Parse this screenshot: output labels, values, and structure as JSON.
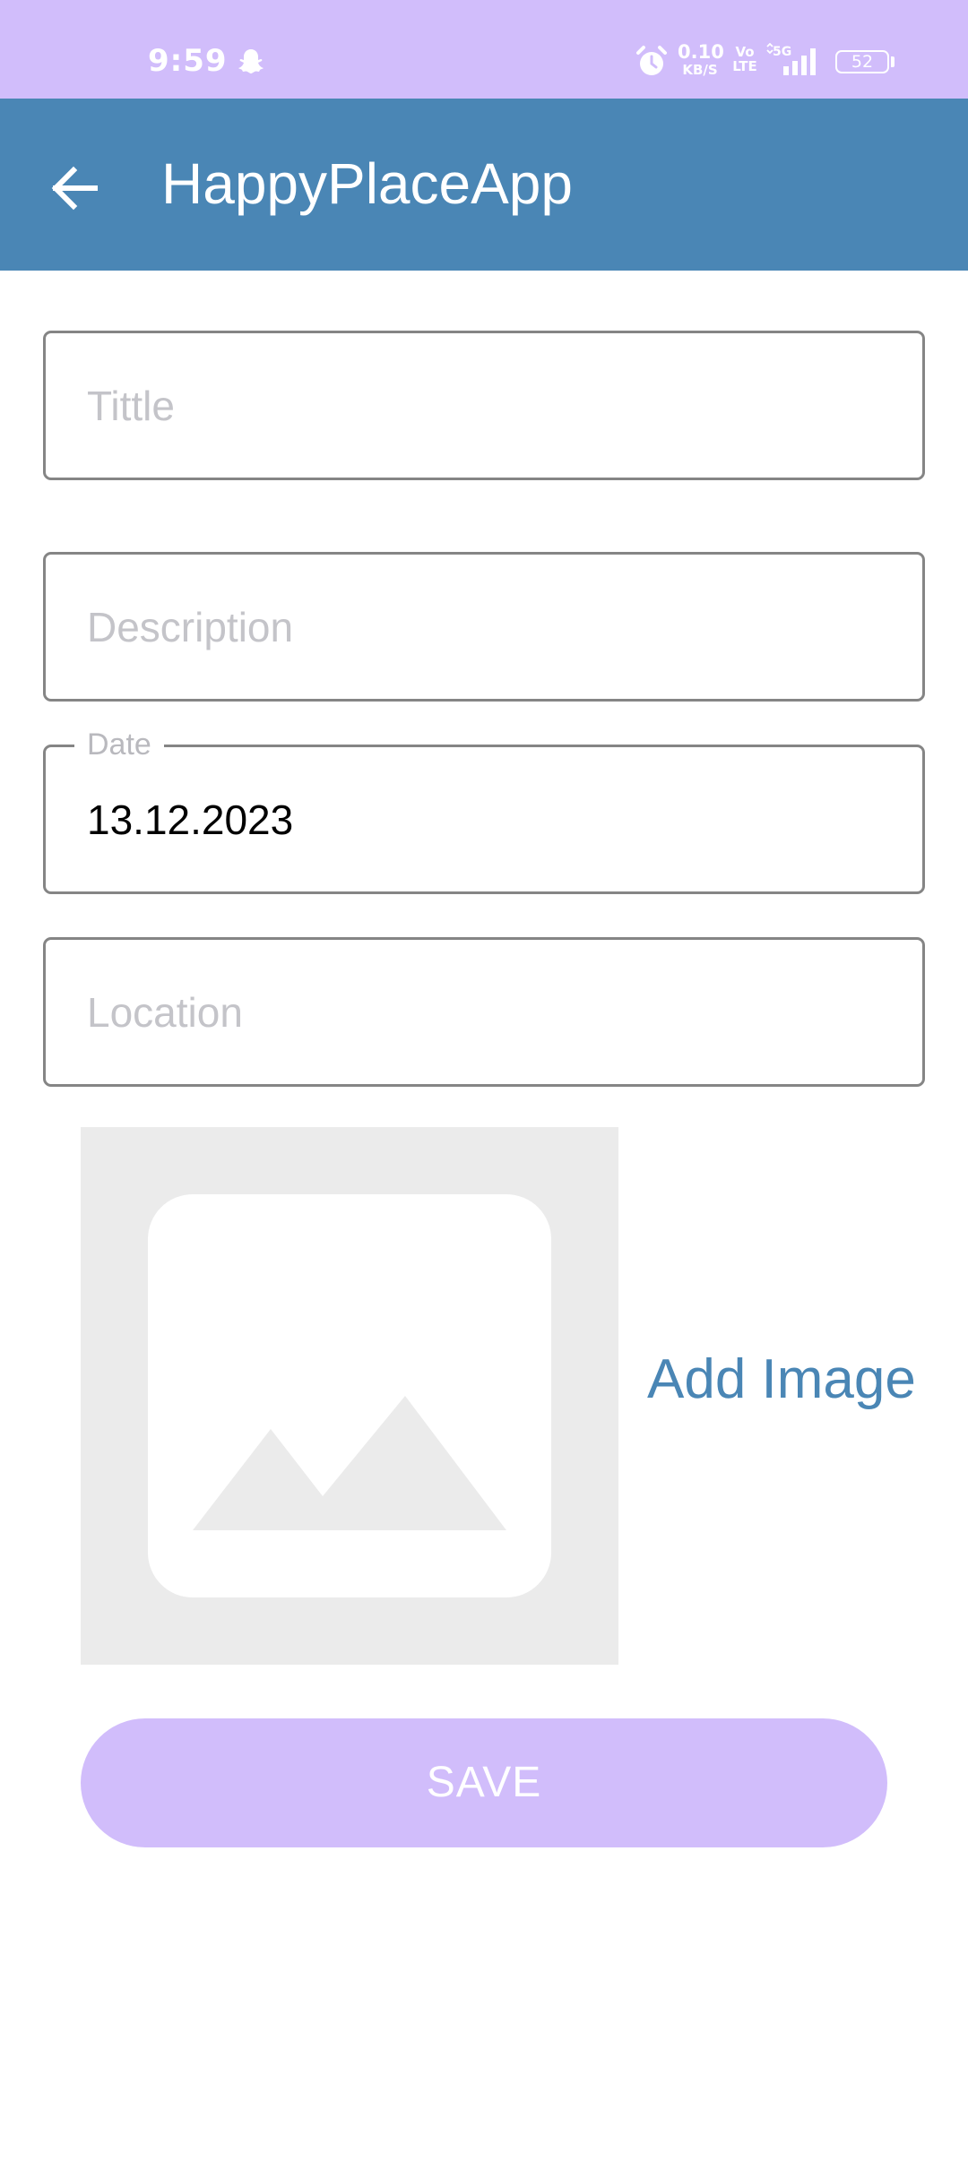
{
  "status_bar": {
    "time": "9:59",
    "net_speed_value": "0.10",
    "net_speed_unit": "KB/S",
    "volte_top": "Vo",
    "volte_bottom": "LTE",
    "network": "5G",
    "battery": "52",
    "icons": [
      "snapchat-icon",
      "alarm-icon",
      "signal-icon",
      "battery-icon"
    ]
  },
  "app_bar": {
    "title": "HappyPlaceApp",
    "color": "#4a86b5"
  },
  "form": {
    "title_placeholder": "Tittle",
    "description_placeholder": "Description",
    "date_label": "Date",
    "date_value": "13.12.2023",
    "location_placeholder": "Location"
  },
  "image_section": {
    "add_image_label": "Add Image"
  },
  "save_button": {
    "label": "SAVE",
    "color": "#d1bdfb"
  }
}
